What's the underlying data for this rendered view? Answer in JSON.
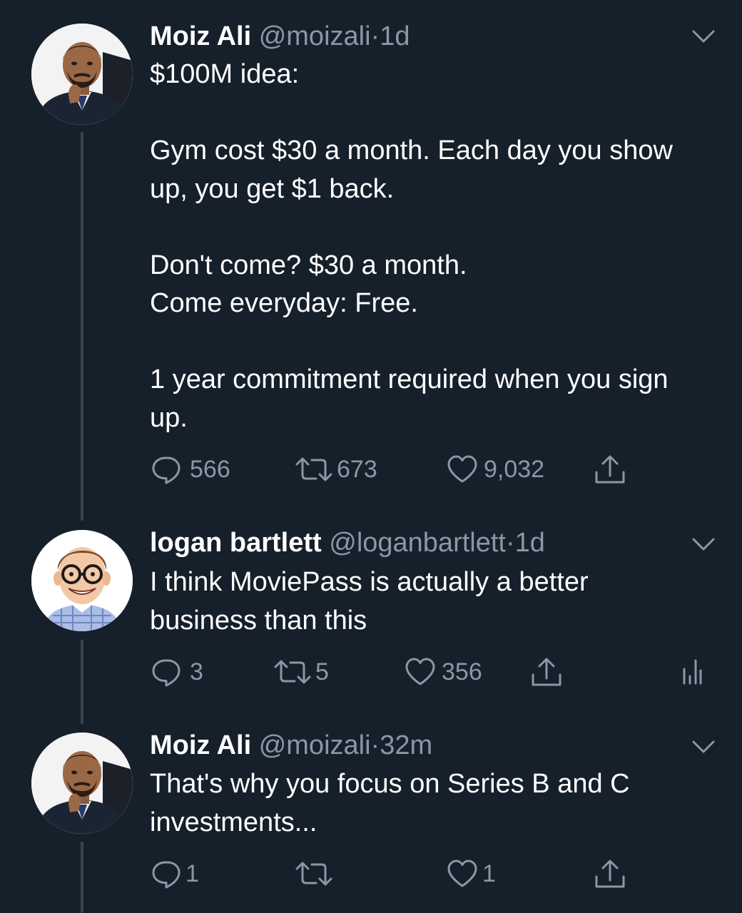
{
  "tweets": [
    {
      "name": "Moiz Ali",
      "handle": "@moizali",
      "separator": "·",
      "time": "1d",
      "text": "$100M idea:\n\nGym cost $30 a month. Each day you show up, you get $1 back.\n\nDon't come? $30 a month.\nCome everyday: Free.\n\n1 year commitment required when you sign up.",
      "replies": "566",
      "retweets": "673",
      "likes": "9,032"
    },
    {
      "name": "logan bartlett",
      "handle": "@loganbartlett",
      "separator": "·",
      "time": "1d",
      "text": "I think MoviePass is actually a better business than this",
      "replies": "3",
      "retweets": "5",
      "likes": "356"
    },
    {
      "name": "Moiz Ali",
      "handle": "@moizali",
      "separator": "·",
      "time": "32m",
      "text": "That's why you focus on Series B and C investments...",
      "replies": "1",
      "retweets": "",
      "likes": "1"
    }
  ],
  "icons": {
    "reply": "reply-icon",
    "retweet": "retweet-icon",
    "like": "heart-icon",
    "share": "share-icon",
    "analytics": "analytics-icon",
    "more": "chevron-down-icon"
  },
  "colors": {
    "background": "#15202b",
    "text": "#ffffff",
    "secondary": "#8899a6",
    "thread_line": "#38444d"
  }
}
